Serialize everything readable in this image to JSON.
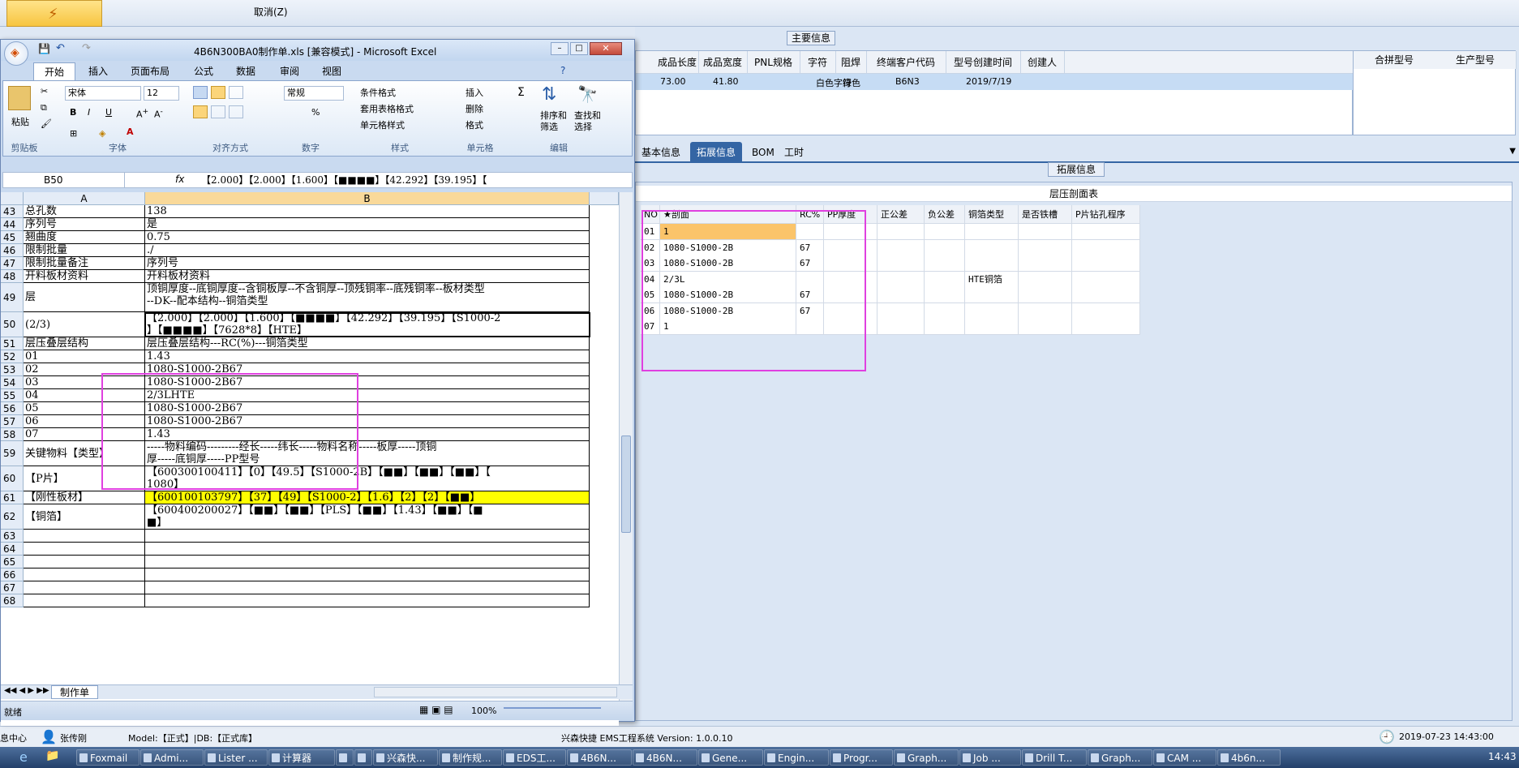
{
  "bg_app": {
    "toolbar_text": "取消(Z)",
    "main_info_title": "主要信息",
    "columns": [
      "成品长度",
      "成品宽度",
      "PNL规格",
      "字符",
      "阻焊",
      "终端客户代码",
      "型号创建时间",
      "创建人"
    ],
    "right_columns": [
      "合拼型号",
      "生产型号"
    ],
    "row": [
      "73.00",
      "41.80",
      "",
      "白色字符",
      "绿色",
      "B6N3",
      "2019/7/19",
      ""
    ],
    "tabs": [
      "基本信息",
      "拓展信息",
      "BOM",
      "工时"
    ],
    "ext_title": "拓展信息",
    "table_title": "层压剖面表",
    "grid_headers": [
      "NO",
      "★剖面",
      "RC%",
      "PP厚度",
      "正公差",
      "负公差",
      "铜箔类型",
      "是否铁槽",
      "P片钻孔程序"
    ],
    "grid_rows": [
      {
        "no": "01",
        "profile": "1",
        "rc": "",
        "foil": ""
      },
      {
        "no": "02",
        "profile": "1080-S1000-2B",
        "rc": "67",
        "foil": ""
      },
      {
        "no": "03",
        "profile": "1080-S1000-2B",
        "rc": "67",
        "foil": ""
      },
      {
        "no": "04",
        "profile": "2/3L",
        "rc": "",
        "foil": "HTE铜箔"
      },
      {
        "no": "05",
        "profile": "1080-S1000-2B",
        "rc": "67",
        "foil": ""
      },
      {
        "no": "06",
        "profile": "1080-S1000-2B",
        "rc": "67",
        "foil": ""
      },
      {
        "no": "07",
        "profile": "1",
        "rc": "",
        "foil": ""
      }
    ],
    "status_left": "息中心",
    "user": "张传刚",
    "model_text": "Model:【正式】|DB:【正式库】",
    "system_text": "兴森快捷 EMS工程系统 Version: 1.0.0.10",
    "datetime": "2019-07-23 14:43:00"
  },
  "excel": {
    "title": "4B6N300BA0制作单.xls [兼容模式] - Microsoft Excel",
    "ribbon_tabs": [
      "开始",
      "插入",
      "页面布局",
      "公式",
      "数据",
      "审阅",
      "视图"
    ],
    "font_name": "宋体",
    "font_size": "12",
    "number_format": "常规",
    "group_labels": [
      "剪贴板",
      "字体",
      "对齐方式",
      "数字",
      "样式",
      "单元格",
      "编辑"
    ],
    "paste": "粘贴",
    "style_buttons": [
      "条件格式",
      "套用表格格式",
      "单元格样式"
    ],
    "cell_buttons": [
      "插入",
      "删除",
      "格式"
    ],
    "edit_buttons": [
      "排序和筛选",
      "查找和选择"
    ],
    "name_box": "B50",
    "formula": "【2.000】【2.000】【1.600】【■■■■】【42.292】【39.195】【",
    "col_headers": [
      "A",
      "B"
    ],
    "rows": [
      {
        "n": "43",
        "a": "总孔数",
        "b": "138"
      },
      {
        "n": "44",
        "a": "序列号",
        "b": "是"
      },
      {
        "n": "45",
        "a": "翘曲度",
        "b": "0.75"
      },
      {
        "n": "46",
        "a": "限制批量",
        "b": "./"
      },
      {
        "n": "47",
        "a": "限制批量备注",
        "b": "序列号"
      },
      {
        "n": "48",
        "a": "开料板材资料",
        "b": "开料板材资料"
      },
      {
        "n": "49",
        "a": "层",
        "b": "顶铜厚度--底铜厚度--含铜板厚--不含铜厚--顶残铜率--底残铜率--板材类型",
        "b2": "--DK--配本结构--铜箔类型"
      },
      {
        "n": "50",
        "a": "(2/3)",
        "b": "【2.000】【2.000】【1.600】【■■■■】【42.292】【39.195】【S1000-2",
        "b2": "】【■■■■】【7628*8】【HTE】"
      },
      {
        "n": "51",
        "a": "层压叠层结构",
        "b": "层压叠层结构---RC(%)---铜箔类型"
      },
      {
        "n": "52",
        "a": "01",
        "b": "1.43"
      },
      {
        "n": "53",
        "a": "02",
        "b": "1080-S1000-2B67"
      },
      {
        "n": "54",
        "a": "03",
        "b": "1080-S1000-2B67"
      },
      {
        "n": "55",
        "a": "04",
        "b": "2/3LHTE"
      },
      {
        "n": "56",
        "a": "05",
        "b": "1080-S1000-2B67"
      },
      {
        "n": "57",
        "a": "06",
        "b": "1080-S1000-2B67"
      },
      {
        "n": "58",
        "a": "07",
        "b": "1.43"
      },
      {
        "n": "59",
        "a": "关键物料【类型】",
        "b": "-----物料编码---------经长-----纬长-----物料名称-----板厚-----顶铜",
        "b2": "厚-----底铜厚-----PP型号"
      },
      {
        "n": "60",
        "a": "【P片】",
        "b": "【600300100411】【0】【49.5】【S1000-2B】【■■】【■■】【■■】【",
        "b2": "1080】"
      },
      {
        "n": "61",
        "a": "【刚性板材】",
        "b": "【600100103797】【37】【49】【S1000-2】【1.6】【2】【2】【■■】"
      },
      {
        "n": "62",
        "a": "【铜箔】",
        "b": "【600400200027】【■■】【■■】【PLS】【■■】【1.43】【■■】【■",
        "b2": "■】"
      },
      {
        "n": "63",
        "a": "",
        "b": ""
      },
      {
        "n": "64",
        "a": "",
        "b": ""
      },
      {
        "n": "65",
        "a": "",
        "b": ""
      },
      {
        "n": "66",
        "a": "",
        "b": ""
      },
      {
        "n": "67",
        "a": "",
        "b": ""
      },
      {
        "n": "68",
        "a": "",
        "b": ""
      }
    ],
    "sheet_tab": "制作单",
    "status": "就绪",
    "zoom": "100%"
  },
  "taskbar": {
    "items": [
      "Foxmail",
      "Admi...",
      "Lister ...",
      "计算器",
      "",
      "",
      "兴森快...",
      "制作规...",
      "EDS工...",
      "4B6N...",
      "4B6N...",
      "Gene...",
      "Engin...",
      "Progr...",
      "Graph...",
      "Job ...",
      "Drill T...",
      "Graph...",
      "CAM ...",
      "4b6n..."
    ],
    "clock": "14:43"
  }
}
